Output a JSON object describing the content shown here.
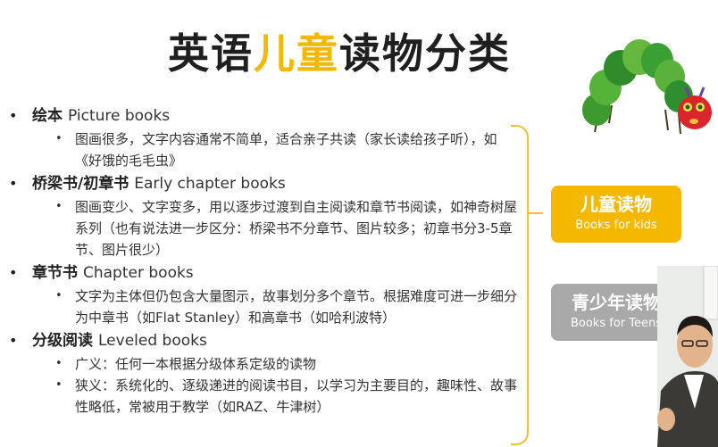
{
  "title": {
    "part1": "英语",
    "highlight": "儿童",
    "part2": "读物分类"
  },
  "sections": [
    {
      "cn": "绘本",
      "en": "Picture books",
      "items": [
        "图画很多，文字内容通常不简单，适合亲子共读（家长读给孩子听），如《好饿的毛毛虫》"
      ]
    },
    {
      "cn": "桥梁书/初章书",
      "en": "Early chapter books",
      "items": [
        "图画变少、文字变多，用以逐步过渡到自主阅读和章节书阅读，如神奇树屋系列（也有说法进一步区分：桥梁书不分章节、图片较多；初章书分3-5章节、图片很少）"
      ]
    },
    {
      "cn": "章节书",
      "en": "Chapter books",
      "items": [
        "文字为主体但仍包含大量图示，故事划分多个章节。根据难度可进一步细分为中章书（如Flat Stanley）和高章书（如哈利波特）"
      ]
    },
    {
      "cn": "分级阅读",
      "en": "Leveled books",
      "items": [
        "广义：任何一本根据分级体系定级的读物",
        "狭义：系统化的、逐级递进的阅读书目，以学习为主要目的，趣味性、故事性略低，常被用于教学（如RAZ、牛津树）"
      ]
    }
  ],
  "boxes": {
    "kids": {
      "cn": "儿童读物",
      "en": "Books for kids",
      "color": "#f5b800"
    },
    "teens": {
      "cn": "青少年读物",
      "en": "Books for Teens",
      "color": "#a9a9a9"
    }
  },
  "bullets": {
    "main": "•",
    "sub": "•"
  }
}
